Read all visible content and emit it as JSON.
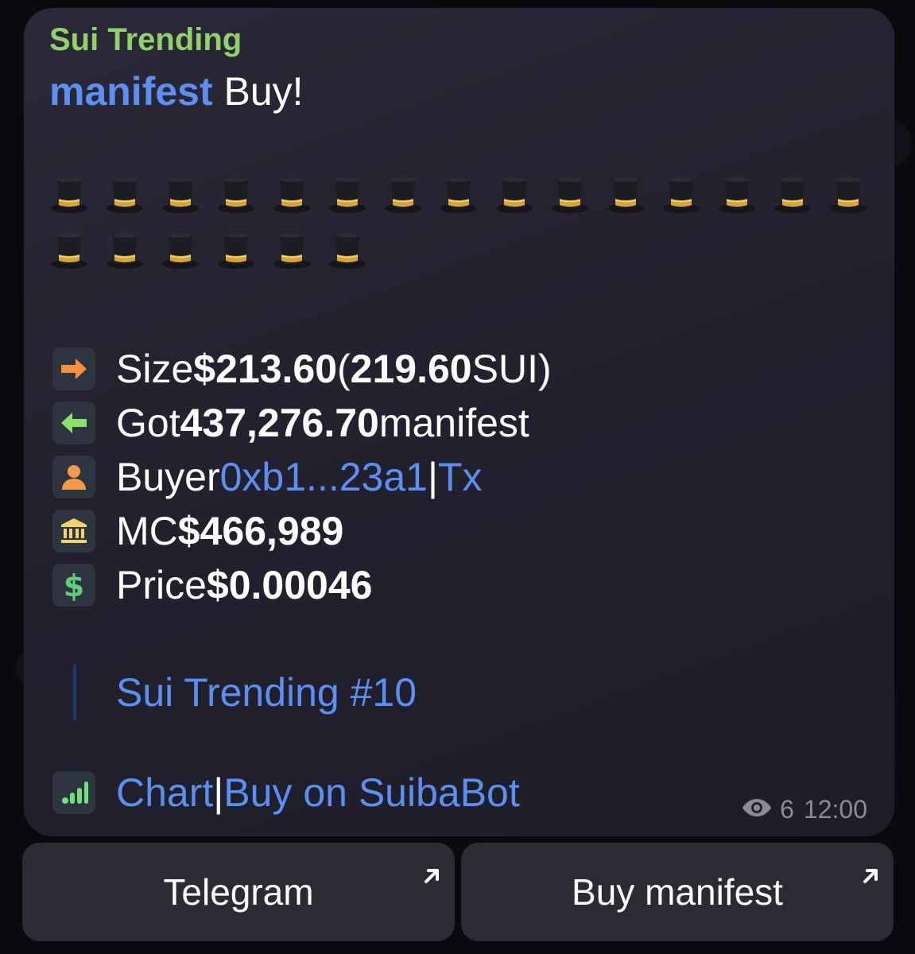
{
  "message": {
    "sender": "Sui Trending",
    "headline_token": "manifest",
    "headline_rest": " Buy!",
    "hat_emoji_count": 21,
    "rows": [
      {
        "icon": "right-arrow-icon",
        "label": "Size ",
        "value": "$213.60",
        "extra_paren_open": " (",
        "extra_bold": "219.60",
        "extra_tail": " SUI)"
      },
      {
        "icon": "left-arrow-icon",
        "label": "Got ",
        "value": "437,276.70",
        "tail": " manifest"
      },
      {
        "icon": "person-icon",
        "label": "Buyer ",
        "buyer_link": "0xb1...23a1",
        "sep": " | ",
        "tx_link": "Tx"
      },
      {
        "icon": "bank-icon",
        "label": "MC ",
        "value": "$466,989"
      },
      {
        "icon": "dollar-icon",
        "label": "Price ",
        "value": "$0.00046"
      }
    ],
    "quote": "Sui Trending #10",
    "chart_link": "Chart",
    "chart_sep": " | ",
    "buy_link": "Buy on SuibaBot",
    "views": "6",
    "time": "12:00"
  },
  "buttons": {
    "telegram": "Telegram",
    "buy": "Buy manifest"
  },
  "colors": {
    "sender": "#8fd16a",
    "link": "#5b8ff0",
    "bubble": "#26232f",
    "button": "#2c2b33"
  }
}
